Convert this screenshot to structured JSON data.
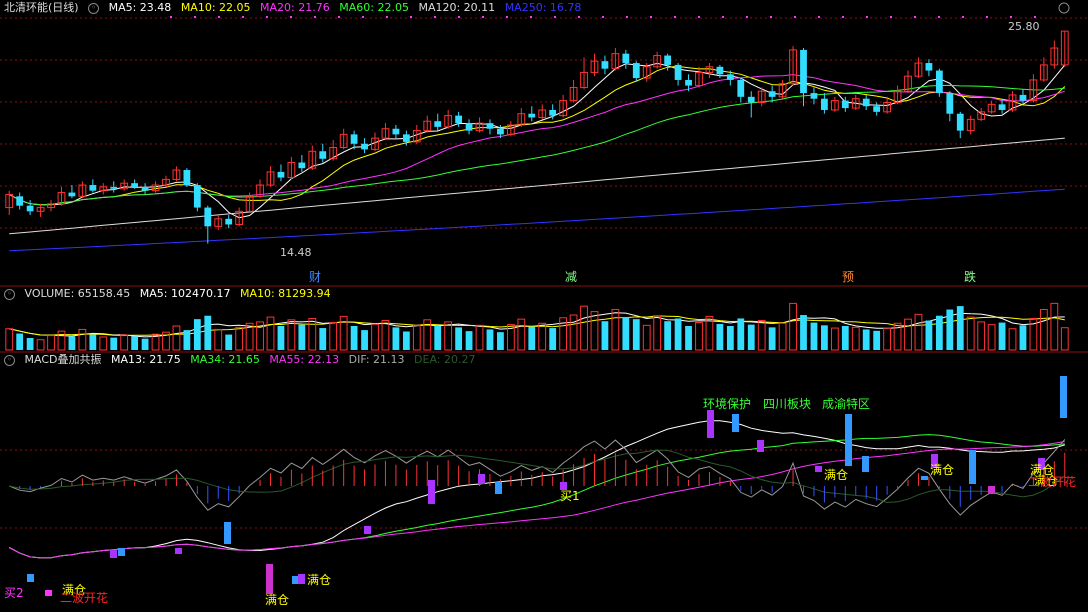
{
  "price_header": {
    "title": "北清环能(日线)",
    "items": [
      {
        "text": "MA5: 23.48",
        "color": "#ffffff"
      },
      {
        "text": "MA10: 22.05",
        "color": "#ffff00"
      },
      {
        "text": "MA20: 21.76",
        "color": "#ff33ff"
      },
      {
        "text": "MA60: 22.05",
        "color": "#33ff33"
      },
      {
        "text": "MA120: 20.11",
        "color": "#dddddd"
      },
      {
        "text": "MA250: 16.78",
        "color": "#3333ff"
      }
    ]
  },
  "price_labels": {
    "high": "25.80",
    "low": "14.48"
  },
  "event_markers": [
    {
      "text": "财",
      "color": "#4488ff"
    },
    {
      "text": "减",
      "color": "#88ff88"
    },
    {
      "text": "预",
      "color": "#ff8833"
    },
    {
      "text": "跌",
      "color": "#88ff88"
    }
  ],
  "volume_header": {
    "title": "VOLUME: 65158.45",
    "items": [
      {
        "text": "MA5: 102470.17",
        "color": "#ffffff"
      },
      {
        "text": "MA10: 81293.94",
        "color": "#ffff00"
      }
    ]
  },
  "macd_header": {
    "title": "MACD叠加共振",
    "items": [
      {
        "text": "MA13: 21.75",
        "color": "#ffffff"
      },
      {
        "text": "MA34: 21.65",
        "color": "#33ff33"
      },
      {
        "text": "MA55: 22.13",
        "color": "#ff33ff"
      },
      {
        "text": "DIF: 21.13",
        "color": "#aaaaaa"
      },
      {
        "text": "DEA: 20.27",
        "color": "#225522"
      }
    ]
  },
  "annotations": [
    {
      "text": "环境保护",
      "color": "#33ff33"
    },
    {
      "text": "四川板块",
      "color": "#33ff33"
    },
    {
      "text": "成渝特区",
      "color": "#33ff33"
    },
    {
      "text": "满仓",
      "color": "#ffff00"
    },
    {
      "text": "满仓",
      "color": "#ffff00"
    },
    {
      "text": "满仓",
      "color": "#ffff00"
    },
    {
      "text": "满仓",
      "color": "#ffff00"
    },
    {
      "text": "满仓",
      "color": "#ffff00"
    },
    {
      "text": "满仓",
      "color": "#ffff00"
    },
    {
      "text": "满仓",
      "color": "#ffff00"
    },
    {
      "text": "买2",
      "color": "#ff33ff"
    },
    {
      "text": "买1",
      "color": "#ffff00"
    },
    {
      "text": "二波开花",
      "color": "#ff2222"
    },
    {
      "text": "二波开花",
      "color": "#ff2222"
    }
  ],
  "colors": {
    "up": "#ff3232",
    "down": "#33ddff",
    "grid": "#8a1010",
    "ma5": "#ffffff",
    "ma10": "#ffff00",
    "ma20": "#ff33ff",
    "ma60": "#33ff33",
    "ma120": "#dddddd",
    "ma250": "#3333ff"
  },
  "chart_data": {
    "type": "candlestick",
    "price": {
      "ylim": [
        13.5,
        26.5
      ],
      "high": 25.8,
      "low": 14.48,
      "candles": [
        {
          "o": 16.4,
          "c": 17.1,
          "h": 17.3,
          "l": 16.0
        },
        {
          "o": 17.0,
          "c": 16.5,
          "h": 17.2,
          "l": 16.3
        },
        {
          "o": 16.5,
          "c": 16.2,
          "h": 16.8,
          "l": 16.0
        },
        {
          "o": 16.2,
          "c": 16.4,
          "h": 16.6,
          "l": 15.9
        },
        {
          "o": 16.4,
          "c": 16.6,
          "h": 16.8,
          "l": 16.2
        },
        {
          "o": 16.6,
          "c": 17.2,
          "h": 17.5,
          "l": 16.5
        },
        {
          "o": 17.2,
          "c": 17.0,
          "h": 17.6,
          "l": 16.9
        },
        {
          "o": 17.0,
          "c": 17.6,
          "h": 17.8,
          "l": 16.9
        },
        {
          "o": 17.6,
          "c": 17.3,
          "h": 17.9,
          "l": 17.2
        },
        {
          "o": 17.3,
          "c": 17.5,
          "h": 17.7,
          "l": 17.1
        },
        {
          "o": 17.5,
          "c": 17.4,
          "h": 17.8,
          "l": 17.2
        },
        {
          "o": 17.4,
          "c": 17.7,
          "h": 17.9,
          "l": 17.3
        },
        {
          "o": 17.7,
          "c": 17.5,
          "h": 17.9,
          "l": 17.4
        },
        {
          "o": 17.5,
          "c": 17.3,
          "h": 17.7,
          "l": 17.1
        },
        {
          "o": 17.3,
          "c": 17.6,
          "h": 17.8,
          "l": 17.2
        },
        {
          "o": 17.6,
          "c": 17.9,
          "h": 18.1,
          "l": 17.5
        },
        {
          "o": 17.9,
          "c": 18.4,
          "h": 18.6,
          "l": 17.8
        },
        {
          "o": 18.4,
          "c": 17.6,
          "h": 18.5,
          "l": 17.5
        },
        {
          "o": 17.6,
          "c": 16.4,
          "h": 17.7,
          "l": 16.2
        },
        {
          "o": 16.4,
          "c": 15.4,
          "h": 16.5,
          "l": 14.48
        },
        {
          "o": 15.4,
          "c": 15.8,
          "h": 16.0,
          "l": 15.2
        },
        {
          "o": 15.8,
          "c": 15.5,
          "h": 16.0,
          "l": 15.3
        },
        {
          "o": 15.5,
          "c": 16.2,
          "h": 16.4,
          "l": 15.4
        },
        {
          "o": 16.2,
          "c": 17.0,
          "h": 17.2,
          "l": 16.1
        },
        {
          "o": 17.0,
          "c": 17.6,
          "h": 17.9,
          "l": 16.9
        },
        {
          "o": 17.6,
          "c": 18.3,
          "h": 18.6,
          "l": 17.5
        },
        {
          "o": 18.3,
          "c": 18.0,
          "h": 18.7,
          "l": 17.8
        },
        {
          "o": 18.0,
          "c": 18.8,
          "h": 19.1,
          "l": 17.9
        },
        {
          "o": 18.8,
          "c": 18.5,
          "h": 19.2,
          "l": 18.3
        },
        {
          "o": 18.5,
          "c": 19.4,
          "h": 19.7,
          "l": 18.4
        },
        {
          "o": 19.4,
          "c": 19.0,
          "h": 19.8,
          "l": 18.8
        },
        {
          "o": 19.0,
          "c": 19.6,
          "h": 20.0,
          "l": 18.9
        },
        {
          "o": 19.6,
          "c": 20.3,
          "h": 20.6,
          "l": 19.5
        },
        {
          "o": 20.3,
          "c": 19.8,
          "h": 20.5,
          "l": 19.5
        },
        {
          "o": 19.8,
          "c": 19.5,
          "h": 20.1,
          "l": 19.3
        },
        {
          "o": 19.5,
          "c": 20.1,
          "h": 20.4,
          "l": 19.4
        },
        {
          "o": 20.1,
          "c": 20.6,
          "h": 20.9,
          "l": 20.0
        },
        {
          "o": 20.6,
          "c": 20.3,
          "h": 20.8,
          "l": 20.1
        },
        {
          "o": 20.3,
          "c": 19.9,
          "h": 20.5,
          "l": 19.7
        },
        {
          "o": 19.9,
          "c": 20.5,
          "h": 20.8,
          "l": 19.8
        },
        {
          "o": 20.5,
          "c": 21.0,
          "h": 21.3,
          "l": 20.4
        },
        {
          "o": 21.0,
          "c": 20.7,
          "h": 21.4,
          "l": 20.5
        },
        {
          "o": 20.7,
          "c": 21.3,
          "h": 21.6,
          "l": 20.6
        },
        {
          "o": 21.3,
          "c": 20.9,
          "h": 21.5,
          "l": 20.7
        },
        {
          "o": 20.9,
          "c": 20.5,
          "h": 21.1,
          "l": 20.3
        },
        {
          "o": 20.5,
          "c": 20.9,
          "h": 21.2,
          "l": 20.4
        },
        {
          "o": 20.9,
          "c": 20.6,
          "h": 21.1,
          "l": 20.3
        },
        {
          "o": 20.6,
          "c": 20.3,
          "h": 20.8,
          "l": 20.1
        },
        {
          "o": 20.3,
          "c": 20.8,
          "h": 21.0,
          "l": 20.2
        },
        {
          "o": 20.8,
          "c": 21.4,
          "h": 21.7,
          "l": 20.7
        },
        {
          "o": 21.4,
          "c": 21.2,
          "h": 21.8,
          "l": 21.0
        },
        {
          "o": 21.2,
          "c": 21.6,
          "h": 21.9,
          "l": 21.1
        },
        {
          "o": 21.6,
          "c": 21.3,
          "h": 21.9,
          "l": 21.1
        },
        {
          "o": 21.3,
          "c": 22.1,
          "h": 22.4,
          "l": 21.2
        },
        {
          "o": 22.1,
          "c": 22.8,
          "h": 23.2,
          "l": 22.0
        },
        {
          "o": 22.8,
          "c": 23.6,
          "h": 24.4,
          "l": 22.7
        },
        {
          "o": 23.6,
          "c": 24.2,
          "h": 24.6,
          "l": 23.4
        },
        {
          "o": 24.2,
          "c": 23.8,
          "h": 24.5,
          "l": 23.5
        },
        {
          "o": 23.8,
          "c": 24.6,
          "h": 24.9,
          "l": 23.7
        },
        {
          "o": 24.6,
          "c": 24.1,
          "h": 24.8,
          "l": 23.8
        },
        {
          "o": 24.1,
          "c": 23.3,
          "h": 24.2,
          "l": 23.1
        },
        {
          "o": 23.3,
          "c": 23.9,
          "h": 24.1,
          "l": 23.1
        },
        {
          "o": 23.9,
          "c": 24.5,
          "h": 24.7,
          "l": 23.8
        },
        {
          "o": 24.5,
          "c": 24.0,
          "h": 24.6,
          "l": 23.7
        },
        {
          "o": 24.0,
          "c": 23.2,
          "h": 24.1,
          "l": 22.9
        },
        {
          "o": 23.2,
          "c": 22.9,
          "h": 23.5,
          "l": 22.6
        },
        {
          "o": 22.9,
          "c": 23.6,
          "h": 23.9,
          "l": 22.8
        },
        {
          "o": 23.6,
          "c": 23.9,
          "h": 24.1,
          "l": 23.3
        },
        {
          "o": 23.9,
          "c": 23.5,
          "h": 24.0,
          "l": 23.3
        },
        {
          "o": 23.5,
          "c": 23.2,
          "h": 23.7,
          "l": 22.9
        },
        {
          "o": 23.2,
          "c": 22.3,
          "h": 23.3,
          "l": 22.0
        },
        {
          "o": 22.3,
          "c": 22.0,
          "h": 22.6,
          "l": 21.2
        },
        {
          "o": 22.0,
          "c": 22.6,
          "h": 22.8,
          "l": 21.8
        },
        {
          "o": 22.6,
          "c": 22.3,
          "h": 22.9,
          "l": 22.0
        },
        {
          "o": 22.3,
          "c": 23.0,
          "h": 23.2,
          "l": 22.2
        },
        {
          "o": 23.0,
          "c": 24.8,
          "h": 25.0,
          "l": 22.9
        },
        {
          "o": 24.8,
          "c": 22.5,
          "h": 24.9,
          "l": 21.8
        },
        {
          "o": 22.5,
          "c": 22.2,
          "h": 22.8,
          "l": 21.9
        },
        {
          "o": 22.2,
          "c": 21.6,
          "h": 22.5,
          "l": 21.4
        },
        {
          "o": 21.6,
          "c": 22.1,
          "h": 22.3,
          "l": 21.5
        },
        {
          "o": 22.1,
          "c": 21.7,
          "h": 22.3,
          "l": 21.5
        },
        {
          "o": 21.7,
          "c": 22.2,
          "h": 22.4,
          "l": 21.6
        },
        {
          "o": 22.2,
          "c": 21.8,
          "h": 22.4,
          "l": 21.6
        },
        {
          "o": 21.8,
          "c": 21.5,
          "h": 22.0,
          "l": 21.3
        },
        {
          "o": 21.5,
          "c": 22.0,
          "h": 22.3,
          "l": 21.4
        },
        {
          "o": 22.0,
          "c": 22.6,
          "h": 22.9,
          "l": 21.9
        },
        {
          "o": 22.6,
          "c": 23.4,
          "h": 23.7,
          "l": 22.5
        },
        {
          "o": 23.4,
          "c": 24.1,
          "h": 24.4,
          "l": 23.3
        },
        {
          "o": 24.1,
          "c": 23.7,
          "h": 24.3,
          "l": 23.4
        },
        {
          "o": 23.7,
          "c": 22.5,
          "h": 23.8,
          "l": 22.3
        },
        {
          "o": 22.5,
          "c": 21.4,
          "h": 22.6,
          "l": 21.0
        },
        {
          "o": 21.4,
          "c": 20.5,
          "h": 21.5,
          "l": 20.1
        },
        {
          "o": 20.5,
          "c": 21.1,
          "h": 21.3,
          "l": 20.3
        },
        {
          "o": 21.1,
          "c": 21.5,
          "h": 21.7,
          "l": 21.0
        },
        {
          "o": 21.5,
          "c": 21.9,
          "h": 22.1,
          "l": 21.4
        },
        {
          "o": 21.9,
          "c": 21.6,
          "h": 22.2,
          "l": 21.4
        },
        {
          "o": 21.6,
          "c": 22.4,
          "h": 22.6,
          "l": 21.5
        },
        {
          "o": 22.4,
          "c": 22.1,
          "h": 22.7,
          "l": 21.9
        },
        {
          "o": 22.1,
          "c": 23.2,
          "h": 23.5,
          "l": 22.0
        },
        {
          "o": 23.2,
          "c": 24.0,
          "h": 24.4,
          "l": 23.1
        },
        {
          "o": 24.0,
          "c": 24.9,
          "h": 25.3,
          "l": 23.8
        },
        {
          "o": 24.0,
          "c": 25.8,
          "h": 25.8,
          "l": 23.9
        }
      ]
    },
    "volume": [
      62,
      48,
      35,
      30,
      42,
      55,
      40,
      60,
      45,
      38,
      36,
      44,
      40,
      33,
      46,
      52,
      70,
      58,
      90,
      100,
      60,
      45,
      66,
      78,
      82,
      96,
      70,
      88,
      74,
      92,
      64,
      80,
      98,
      70,
      58,
      75,
      86,
      66,
      54,
      72,
      88,
      70,
      82,
      66,
      55,
      72,
      60,
      52,
      74,
      90,
      68,
      78,
      64,
      94,
      102,
      128,
      112,
      84,
      118,
      96,
      90,
      72,
      100,
      84,
      92,
      70,
      80,
      98,
      76,
      70,
      92,
      74,
      86,
      66,
      78,
      136,
      102,
      80,
      72,
      64,
      70,
      66,
      60,
      56,
      64,
      78,
      90,
      104,
      86,
      100,
      118,
      128,
      96,
      82,
      74,
      80,
      62,
      72,
      92,
      118,
      136,
      65
    ]
  }
}
